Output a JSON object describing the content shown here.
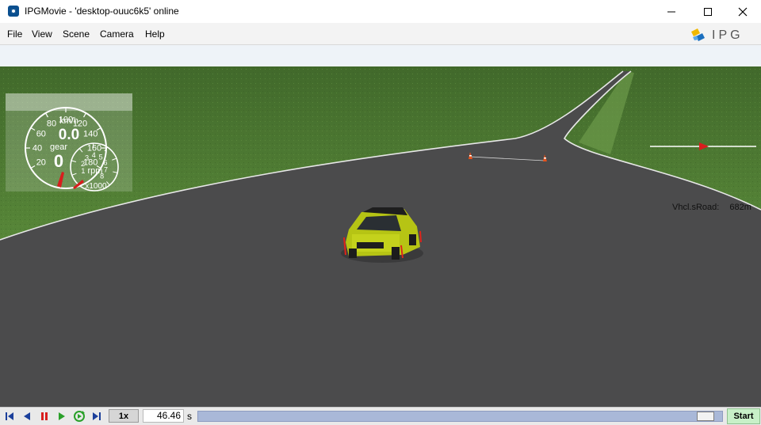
{
  "window": {
    "title": "IPGMovie - 'desktop-ouuc6k5' online"
  },
  "menu": {
    "items": [
      "File",
      "View",
      "Scene",
      "Camera",
      "Help"
    ]
  },
  "logo": {
    "text": "IPG"
  },
  "gauge": {
    "speed_unit": "km/h",
    "speed_value": "0.0",
    "gear_label": "gear",
    "gear_value": "0",
    "speed_ticks": [
      "20",
      "40",
      "60",
      "80",
      "100",
      "120",
      "140",
      "160",
      "180"
    ],
    "rpm_label": "rpm",
    "rpm_multiplier": "x1000",
    "rpm_ticks": [
      "1",
      "2",
      "3",
      "4",
      "5",
      "6",
      "7",
      "8"
    ]
  },
  "hud": {
    "sroad_label": "Vhcl.sRoad:",
    "sroad_value": "682m"
  },
  "toolbar": {
    "speed": "1x",
    "time": "46.46",
    "time_unit": "s",
    "progress_fraction": 0.985,
    "start_label": "Start"
  },
  "colors": {
    "grass": "#4d7a33",
    "road": "#4b4b4c",
    "sky": "#eef3f8",
    "car": "#b6c414",
    "accent": "#0a4f8f",
    "start_bg": "#c8f0c8"
  },
  "icons": [
    "skip-start-icon",
    "step-back-icon",
    "pause-icon",
    "play-icon",
    "replay-icon",
    "skip-end-icon",
    "minimize-icon",
    "maximize-icon",
    "close-icon"
  ]
}
